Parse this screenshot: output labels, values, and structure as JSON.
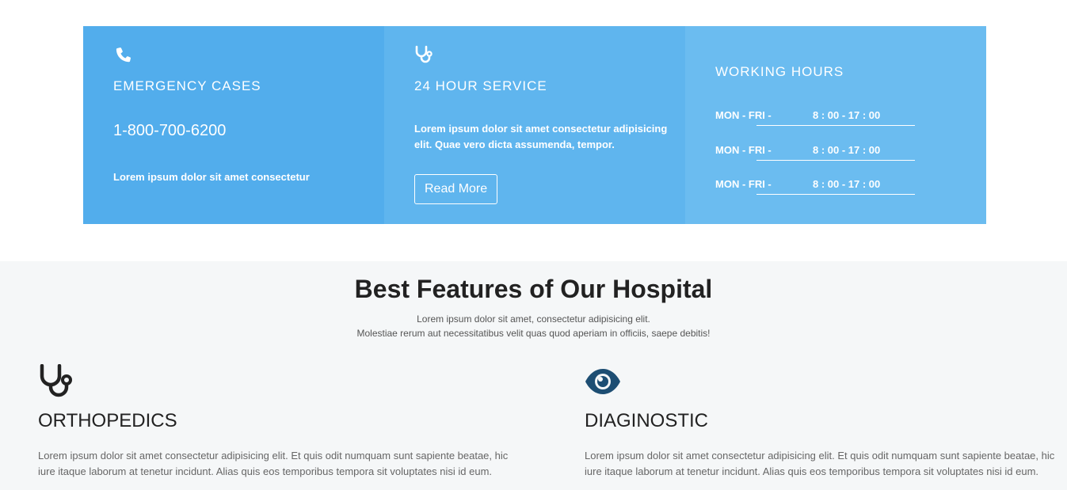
{
  "info": {
    "emergency": {
      "icon": "phone-icon",
      "title": "EMERGENCY CASES",
      "phone": "1-800-700-6200",
      "text": "Lorem ipsum dolor sit amet consectetur"
    },
    "service": {
      "icon": "stethoscope-icon",
      "title": "24 HOUR SERVICE",
      "text": "Lorem ipsum dolor sit amet consectetur adipisicing elit. Quae vero dicta assumenda, tempor.",
      "button": "Read More"
    },
    "hours": {
      "title": "WORKING HOURS",
      "rows": [
        {
          "day": "MON - FRI -",
          "time": "8 : 00 - 17 : 00"
        },
        {
          "day": "MON - FRI -",
          "time": "8 : 00 - 17 : 00"
        },
        {
          "day": "MON - FRI -",
          "time": "8 : 00 - 17 : 00"
        }
      ]
    }
  },
  "features": {
    "heading_bold": "Best Features",
    "heading_rest": " of Our Hospital",
    "subtitle_line1": "Lorem ipsum dolor sit amet, consectetur adipisicing elit.",
    "subtitle_line2": "Molestiae rerum aut necessitatibus velit quas quod aperiam in officiis, saepe debitis!",
    "items": [
      {
        "icon": "stethoscope-icon",
        "title": "ORTHOPEDICS",
        "text": "Lorem ipsum dolor sit amet consectetur adipisicing elit. Et quis odit numquam sunt sapiente beatae, hic iure itaque laborum at tenetur incidunt. Alias quis eos temporibus tempora sit voluptates nisi id eum."
      },
      {
        "icon": "eye-icon",
        "title": "DIAGINOSTIC",
        "text": "Lorem ipsum dolor sit amet consectetur adipisicing elit. Et quis odit numquam sunt sapiente beatae, hic iure itaque laborum at tenetur incidunt. Alias quis eos temporibus tempora sit voluptates nisi id eum."
      }
    ]
  },
  "colors": {
    "col1": "#52adec",
    "col2": "#5fb5ee",
    "col3": "#6bbcf0",
    "features_bg": "#f5f7f8",
    "eye_icon": "#1d4e73"
  }
}
